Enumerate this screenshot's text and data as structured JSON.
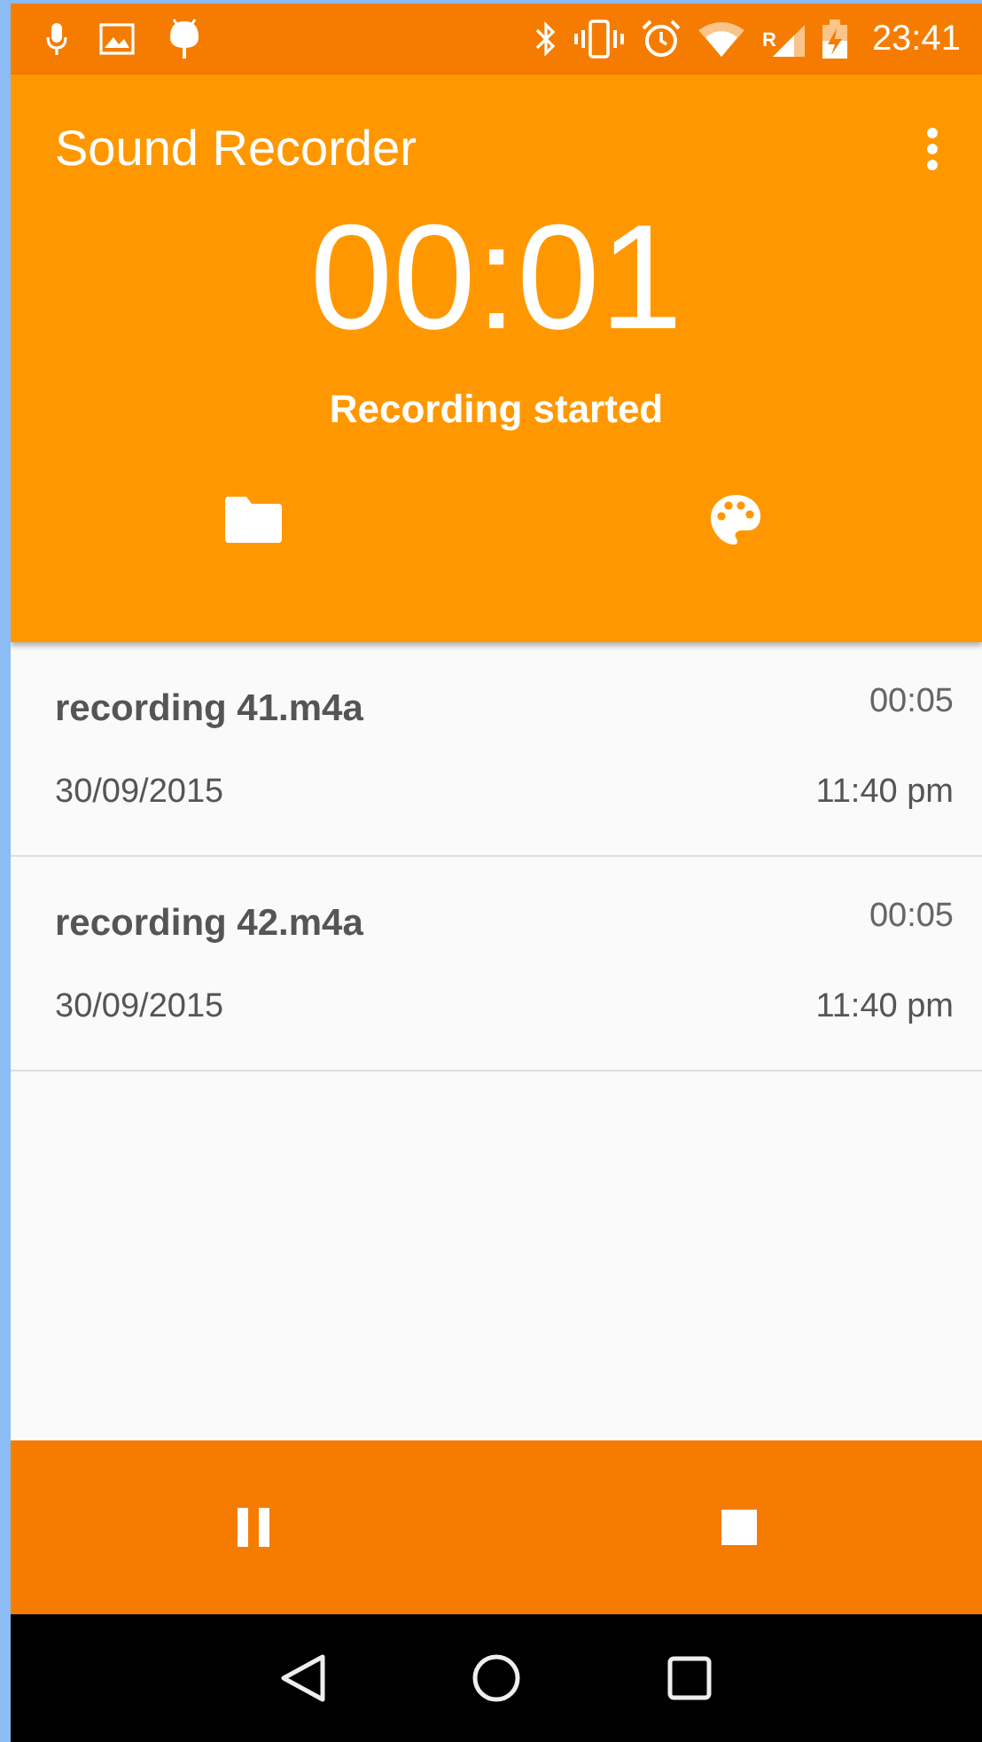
{
  "status_bar": {
    "roaming": "R",
    "time": "23:41"
  },
  "app_bar": {
    "title": "Sound Recorder"
  },
  "recorder": {
    "timer": "00:01",
    "status": "Recording started"
  },
  "recordings": [
    {
      "name": "recording 41.m4a",
      "duration": "00:05",
      "date": "30/09/2015",
      "time": "11:40 pm"
    },
    {
      "name": "recording 42.m4a",
      "duration": "00:05",
      "date": "30/09/2015",
      "time": "11:40 pm"
    }
  ]
}
